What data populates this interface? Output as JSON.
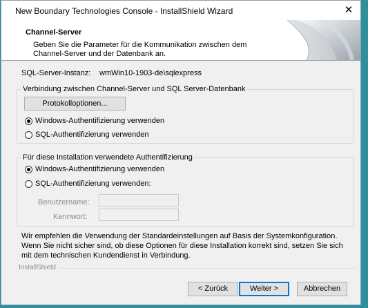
{
  "window": {
    "title": "New Boundary Technologies Console - InstallShield Wizard",
    "close_glyph": "✕"
  },
  "header": {
    "title": "Channel-Server",
    "description": "Geben Sie die Parameter für die Kommunikation zwischen dem Channel-Server und der Datenbank an."
  },
  "sql": {
    "label": "SQL-Server-Instanz:",
    "value": "wmWin10-1903-de\\sqlexpress"
  },
  "connection_group": {
    "legend": "Verbindung zwischen Channel-Server und SQL Server-Datenbank",
    "protocol_button": "Protokolloptionen...",
    "options": [
      {
        "label": "Windows-Authentifizierung verwenden",
        "checked": true
      },
      {
        "label": "SQL-Authentifizierung verwenden",
        "checked": false
      }
    ]
  },
  "install_group": {
    "legend": "Für diese Installation verwendete Authentifizierung",
    "options": [
      {
        "label": "Windows-Authentifizierung verwenden",
        "checked": true
      },
      {
        "label": "SQL-Authentifizierung verwenden:",
        "checked": false
      }
    ],
    "username_label": "Benutzername:",
    "password_label": "Kennwort:",
    "username_value": "",
    "password_value": ""
  },
  "info": "Wir empfehlen die Verwendung der Standardeinstellungen auf Basis der Systemkonfiguration. Wenn Sie nicht sicher sind, ob diese Optionen für diese Installation korrekt sind, setzen Sie sich mit dem technischen Kundendienst in Verbindung.",
  "brand": "InstallShield",
  "buttons": {
    "back": "< Zurück",
    "next": "Weiter >",
    "cancel": "Abbrechen"
  }
}
